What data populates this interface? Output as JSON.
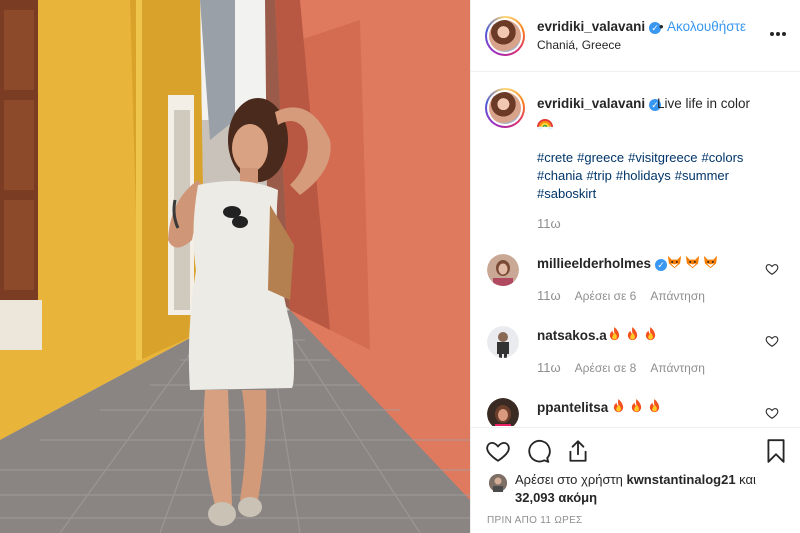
{
  "post": {
    "username": "evridiki_valavani",
    "follow_label": "Ακολουθήστε",
    "separator": "•",
    "location": "Chaniá, Greece",
    "more_label": "•••"
  },
  "caption": {
    "username": "evridiki_valavani",
    "text": "Live life in color",
    "hashtags": [
      "#crete",
      "#greece",
      "#visitgreece",
      "#colors",
      "#chania",
      "#trip",
      "#holidays",
      "#summer",
      "#saboskirt"
    ],
    "time": "11ω"
  },
  "comments": [
    {
      "username": "millieelderholmes",
      "verified": true,
      "emoji": [
        "fox-face",
        "fox-face",
        "fox-face"
      ],
      "time": "11ω",
      "likes": "Αρέσει σε 6",
      "reply": "Απάντηση"
    },
    {
      "username": "natsakos.a",
      "verified": false,
      "emoji": [
        "fire",
        "fire",
        "fire"
      ],
      "time": "11ω",
      "likes": "Αρέσει σε 8",
      "reply": "Απάντηση"
    },
    {
      "username": "ppantelitsa",
      "verified": false,
      "emoji": [
        "fire",
        "fire",
        "fire"
      ],
      "time": "",
      "likes": "",
      "reply": ""
    }
  ],
  "likes": {
    "prefix": "Αρέσει στο χρήστη",
    "user": "kwnstantinalog21",
    "joiner": "και",
    "count": "32,093",
    "suffix": "ακόμη"
  },
  "posted": "ΠΡΙΝ ΑΠΟ 11 ΩΡΕΣ",
  "colors": {
    "link": "#3897f0",
    "hashtag": "#003569",
    "muted": "#8e8e8e",
    "text": "#262626",
    "border": "#efefef"
  },
  "icons": [
    "verified-badge-icon",
    "more-options-icon",
    "heart-icon",
    "comment-icon",
    "share-icon",
    "bookmark-icon",
    "rainbow-emoji",
    "fox-emoji",
    "fire-emoji"
  ]
}
